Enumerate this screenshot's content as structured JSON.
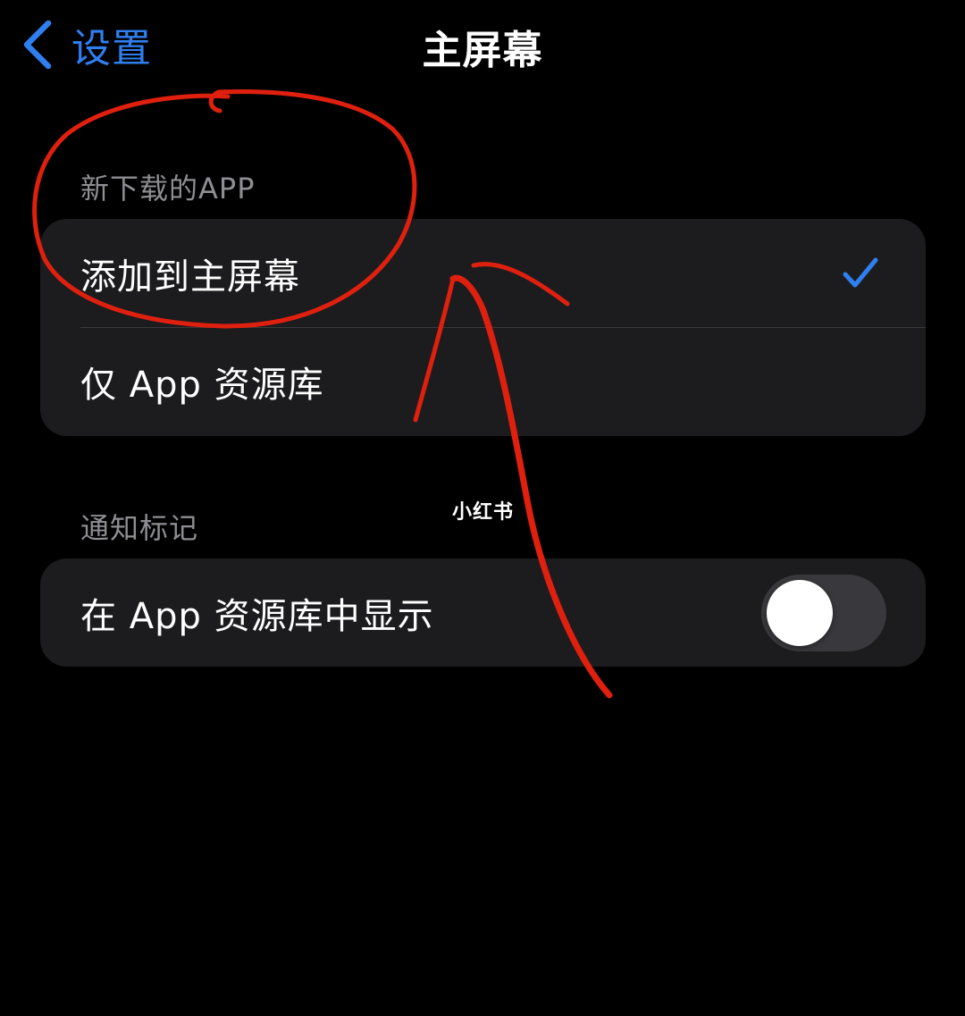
{
  "nav": {
    "back_label": "设置",
    "title": "主屏幕"
  },
  "sections": [
    {
      "header": "新下载的APP",
      "rows": [
        {
          "label": "添加到主屏幕",
          "selected": true
        },
        {
          "label": "仅 App 资源库",
          "selected": false
        }
      ]
    },
    {
      "header": "通知标记",
      "rows": [
        {
          "label": "在 App 资源库中显示",
          "toggle_on": false
        }
      ]
    }
  ],
  "watermark": "小红书",
  "colors": {
    "background": "#000000",
    "group_bg": "#1c1c1e",
    "accent": "#2f7ff0",
    "secondary_text": "#8e8e93",
    "annotation": "#e0200f",
    "toggle_off": "#39393d"
  },
  "icons": {
    "back": "chevron-left-icon",
    "selected": "checkmark-icon"
  }
}
